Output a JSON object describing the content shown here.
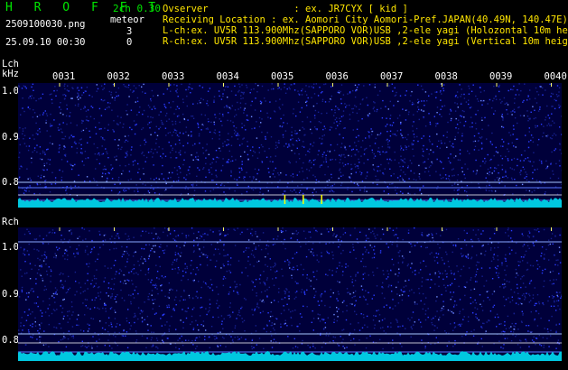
{
  "app_title": "H R O F F T",
  "mode": "2ch 0.30",
  "file": {
    "name": "2509100030.png",
    "timestamp": "25.09.10 00:30"
  },
  "meteor": {
    "label": "meteor",
    "lch_count": "3",
    "rch_count": "0"
  },
  "station": {
    "observer": "Ovserver               : ex. JR7CYX [ kid ]",
    "location": "Receiving Location : ex. Aomori City Aomori-Pref.JAPAN(40.49N, 140.47E)",
    "lch": "L-ch:ex. UV5R 113.900Mhz(SAPPORO VOR)USB ,2-ele yagi (Holozontal 10m height)",
    "rch": "R-ch:ex. UV5R 113.900Mhz(SAPPORO VOR)USB ,2-ele yagi (Vertical 10m height)"
  },
  "lch_panel": {
    "label": "Lch",
    "unit": "kHz",
    "y_ticks": [
      "1.0",
      "0.9",
      "0.8"
    ]
  },
  "rch_panel": {
    "label": "Rch",
    "y_ticks": [
      "1.0",
      "0.9",
      "0.8"
    ]
  },
  "time_ticks": [
    "0031",
    "0032",
    "0033",
    "0034",
    "0035",
    "0036",
    "0037",
    "0038",
    "0039",
    "0040"
  ],
  "colors": {
    "title_green": "#00e600",
    "header_yellow": "#ffe600",
    "spectrum_bg": "#00003a",
    "noise_blue": "#2a3cff",
    "signal_cyan": "#00e5ff",
    "meteor_yellow": "#ffff00"
  }
}
